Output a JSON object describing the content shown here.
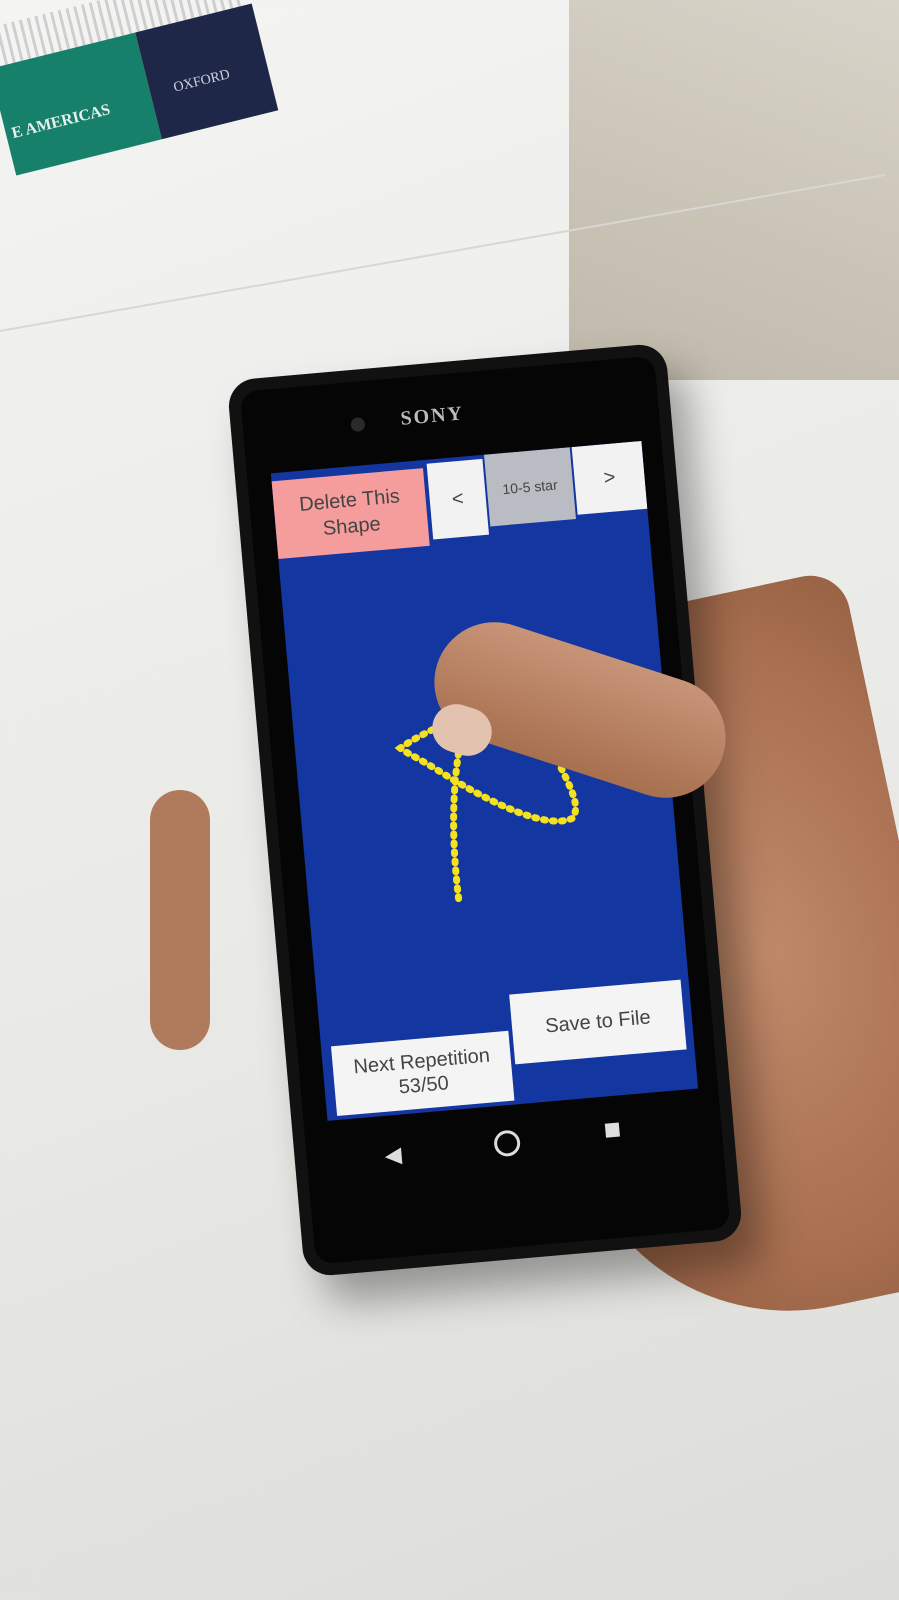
{
  "background": {
    "book_cover_text": "E AMERICAS",
    "book_publisher": "OXFORD"
  },
  "phone": {
    "brand": "SONY",
    "app": {
      "delete_button": "Delete This Shape",
      "prev_button": "<",
      "shape_name": "10-5 star",
      "next_button": ">",
      "next_repetition_label": "Next Repetition",
      "repetition_count": "53/50",
      "save_button": "Save to File"
    },
    "colors": {
      "screen_bg": "#1336a0",
      "stroke": "#f5e11e",
      "delete_bg": "#f59c9c"
    }
  }
}
